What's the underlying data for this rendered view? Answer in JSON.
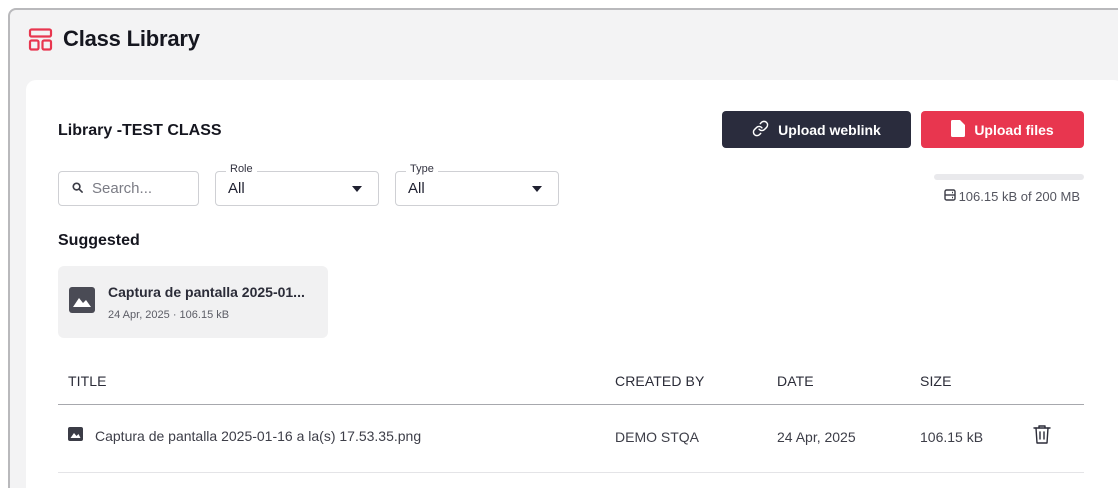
{
  "page": {
    "title": "Class Library",
    "title_icon": "library-icon"
  },
  "library": {
    "title": "Library -TEST CLASS",
    "upload_weblink_label": "Upload weblink",
    "upload_files_label": "Upload files"
  },
  "filters": {
    "search": {
      "placeholder": "Search..."
    },
    "role": {
      "legend": "Role",
      "value": "All"
    },
    "type": {
      "legend": "Type",
      "value": "All"
    }
  },
  "storage": {
    "text": "106.15 kB of 200 MB",
    "used_fraction": 0.0005
  },
  "suggested": {
    "heading": "Suggested",
    "items": [
      {
        "title": "Captura de pantalla 2025-01...",
        "meta": "24 Apr, 2025 · 106.15 kB",
        "icon": "image-icon"
      }
    ]
  },
  "table": {
    "headers": {
      "title": "TITLE",
      "created_by": "CREATED BY",
      "date": "DATE",
      "size": "SIZE"
    },
    "rows": [
      {
        "title": "Captura de pantalla 2025-01-16 a la(s) 17.53.35.png",
        "created_by": "DEMO STQA",
        "date": "24 Apr, 2025",
        "size": "106.15 kB",
        "icon": "image-icon",
        "action_icon": "trash-icon"
      }
    ]
  },
  "colors": {
    "accent": "#e8364f",
    "dark_button": "#2a2c3d",
    "page_bg": "#f3f3f4"
  }
}
